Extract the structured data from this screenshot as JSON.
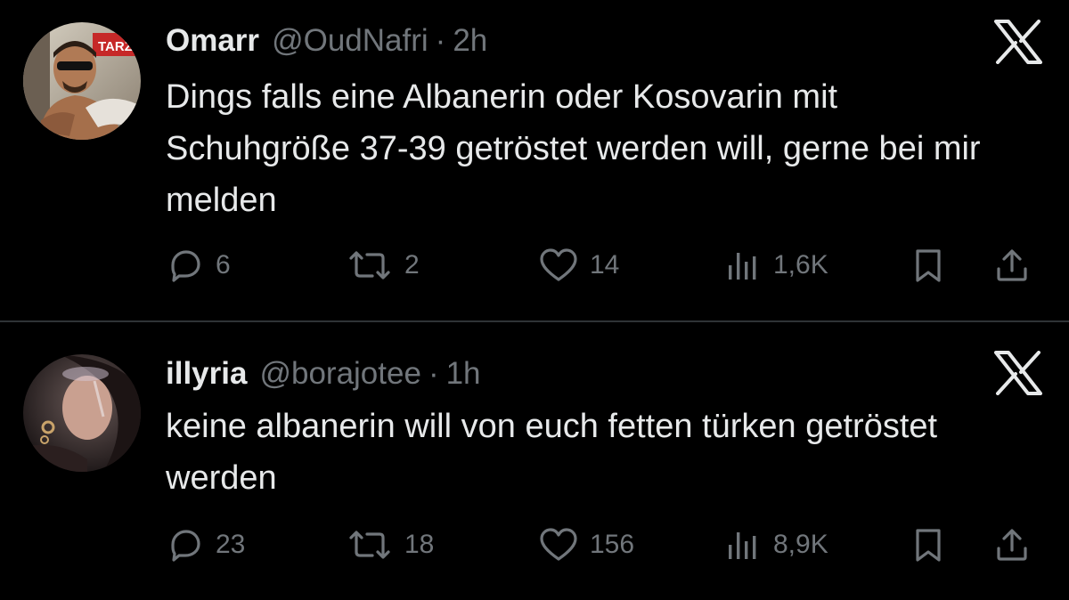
{
  "tweets": [
    {
      "name": "Omarr",
      "handle": "@OudNafri",
      "separator": "·",
      "time": "2h",
      "text": "Dings falls eine Albanerin oder Kosovarin mit Schuhgröße 37-39 getröstet werden will, gerne bei mir melden",
      "avatar_sign_text": "TARZ",
      "replies": "6",
      "retweets": "2",
      "likes": "14",
      "views": "1,6K"
    },
    {
      "name": "illyria",
      "handle": "@borajotee",
      "separator": "·",
      "time": "1h",
      "text": "keine albanerin will von euch fetten türken getröstet werden",
      "replies": "23",
      "retweets": "18",
      "likes": "156",
      "views": "8,9K"
    }
  ],
  "icons": {
    "brand": "x-logo-icon",
    "reply": "reply-icon",
    "retweet": "retweet-icon",
    "like": "heart-icon",
    "views": "views-icon",
    "bookmark": "bookmark-icon",
    "share": "share-icon"
  },
  "colors": {
    "background": "#000000",
    "text": "#e7e9ea",
    "secondary": "#71767b",
    "divider": "#2f3336"
  }
}
